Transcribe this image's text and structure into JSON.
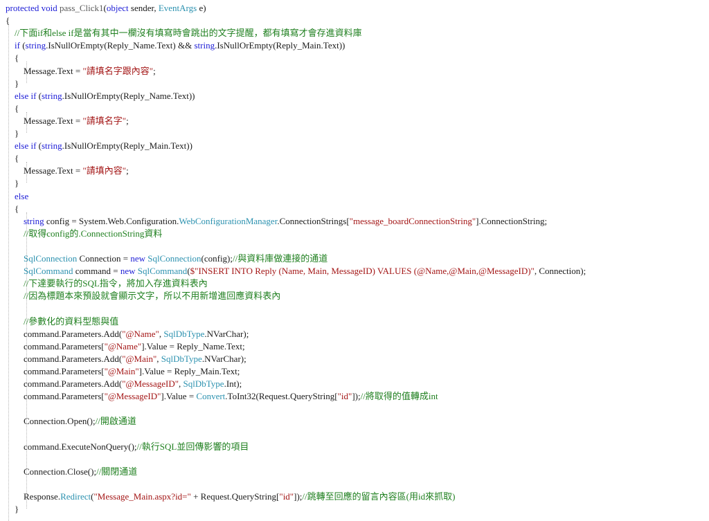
{
  "editor": {
    "lines": [
      [
        {
          "t": "protected void ",
          "c": "kw"
        },
        {
          "t": "pass_Click1",
          "c": "fn"
        },
        {
          "t": "(",
          "c": "pl"
        },
        {
          "t": "object",
          "c": "kw"
        },
        {
          "t": " sender, ",
          "c": "pl"
        },
        {
          "t": "EventArgs",
          "c": "ty"
        },
        {
          "t": " e)",
          "c": "pl"
        }
      ],
      [
        {
          "t": "{",
          "c": "pl"
        }
      ],
      [
        {
          "t": "    //下面if和else if是當有其中一欄沒有填寫時會跳出的文字提醒，都有填寫才會存進資料庫",
          "c": "cm"
        }
      ],
      [
        {
          "t": "    ",
          "c": "pl"
        },
        {
          "t": "if",
          "c": "kw"
        },
        {
          "t": " (",
          "c": "pl"
        },
        {
          "t": "string",
          "c": "kw"
        },
        {
          "t": ".IsNullOrEmpty(Reply_Name.Text) && ",
          "c": "pl"
        },
        {
          "t": "string",
          "c": "kw"
        },
        {
          "t": ".IsNullOrEmpty(Reply_Main.Text))",
          "c": "pl"
        }
      ],
      [
        {
          "t": "    {",
          "c": "pl"
        }
      ],
      [
        {
          "t": "        Message.Text = ",
          "c": "pl"
        },
        {
          "t": "\"請填名字跟內容\"",
          "c": "str"
        },
        {
          "t": ";",
          "c": "pl"
        }
      ],
      [
        {
          "t": "    }",
          "c": "pl"
        }
      ],
      [
        {
          "t": "    ",
          "c": "pl"
        },
        {
          "t": "else if",
          "c": "kw"
        },
        {
          "t": " (",
          "c": "pl"
        },
        {
          "t": "string",
          "c": "kw"
        },
        {
          "t": ".IsNullOrEmpty(Reply_Name.Text))",
          "c": "pl"
        }
      ],
      [
        {
          "t": "    {",
          "c": "pl"
        }
      ],
      [
        {
          "t": "        Message.Text = ",
          "c": "pl"
        },
        {
          "t": "\"請填名字\"",
          "c": "str"
        },
        {
          "t": ";",
          "c": "pl"
        }
      ],
      [
        {
          "t": "    }",
          "c": "pl"
        }
      ],
      [
        {
          "t": "    ",
          "c": "pl"
        },
        {
          "t": "else if",
          "c": "kw"
        },
        {
          "t": " (",
          "c": "pl"
        },
        {
          "t": "string",
          "c": "kw"
        },
        {
          "t": ".IsNullOrEmpty(Reply_Main.Text))",
          "c": "pl"
        }
      ],
      [
        {
          "t": "    {",
          "c": "pl"
        }
      ],
      [
        {
          "t": "        Message.Text = ",
          "c": "pl"
        },
        {
          "t": "\"請填內容\"",
          "c": "str"
        },
        {
          "t": ";",
          "c": "pl"
        }
      ],
      [
        {
          "t": "    }",
          "c": "pl"
        }
      ],
      [
        {
          "t": "    ",
          "c": "pl"
        },
        {
          "t": "else",
          "c": "kw"
        }
      ],
      [
        {
          "t": "    {",
          "c": "pl"
        }
      ],
      [
        {
          "t": "        ",
          "c": "pl"
        },
        {
          "t": "string",
          "c": "kw"
        },
        {
          "t": " config = System.Web.Configuration.",
          "c": "pl"
        },
        {
          "t": "WebConfigurationManager",
          "c": "ty"
        },
        {
          "t": ".ConnectionStrings[",
          "c": "pl"
        },
        {
          "t": "\"message_boardConnectionString\"",
          "c": "str"
        },
        {
          "t": "].ConnectionString;",
          "c": "pl"
        }
      ],
      [
        {
          "t": "        //取得config的.ConnectionString資料",
          "c": "cm"
        }
      ],
      [
        {
          "t": "",
          "c": "pl"
        }
      ],
      [
        {
          "t": "        ",
          "c": "pl"
        },
        {
          "t": "SqlConnection",
          "c": "ty"
        },
        {
          "t": " Connection = ",
          "c": "pl"
        },
        {
          "t": "new",
          "c": "kw"
        },
        {
          "t": " ",
          "c": "pl"
        },
        {
          "t": "SqlConnection",
          "c": "ty"
        },
        {
          "t": "(config);",
          "c": "pl"
        },
        {
          "t": "//與資料庫做連接的通道",
          "c": "cm"
        }
      ],
      [
        {
          "t": "        ",
          "c": "pl"
        },
        {
          "t": "SqlCommand",
          "c": "ty"
        },
        {
          "t": " command = ",
          "c": "pl"
        },
        {
          "t": "new",
          "c": "kw"
        },
        {
          "t": " ",
          "c": "pl"
        },
        {
          "t": "SqlCommand",
          "c": "ty"
        },
        {
          "t": "(",
          "c": "pl"
        },
        {
          "t": "$\"INSERT INTO Reply (Name, Main, MessageID) VALUES (@Name,@Main,@MessageID)\"",
          "c": "str"
        },
        {
          "t": ", Connection);",
          "c": "pl"
        }
      ],
      [
        {
          "t": "        //下達要執行的SQL指令，將加入存進資料表內",
          "c": "cm"
        }
      ],
      [
        {
          "t": "        //因為標題本來預設就會顯示文字，所以不用新增進回應資料表內",
          "c": "cm"
        }
      ],
      [
        {
          "t": "",
          "c": "pl"
        }
      ],
      [
        {
          "t": "        //參數化的資料型態與值",
          "c": "cm"
        }
      ],
      [
        {
          "t": "        command.Parameters.Add(",
          "c": "pl"
        },
        {
          "t": "\"@Name\"",
          "c": "str"
        },
        {
          "t": ", ",
          "c": "pl"
        },
        {
          "t": "SqlDbType",
          "c": "ty"
        },
        {
          "t": ".NVarChar);",
          "c": "pl"
        }
      ],
      [
        {
          "t": "        command.Parameters[",
          "c": "pl"
        },
        {
          "t": "\"@Name\"",
          "c": "str"
        },
        {
          "t": "].Value = Reply_Name.Text;",
          "c": "pl"
        }
      ],
      [
        {
          "t": "        command.Parameters.Add(",
          "c": "pl"
        },
        {
          "t": "\"@Main\"",
          "c": "str"
        },
        {
          "t": ", ",
          "c": "pl"
        },
        {
          "t": "SqlDbType",
          "c": "ty"
        },
        {
          "t": ".NVarChar);",
          "c": "pl"
        }
      ],
      [
        {
          "t": "        command.Parameters[",
          "c": "pl"
        },
        {
          "t": "\"@Main\"",
          "c": "str"
        },
        {
          "t": "].Value = Reply_Main.Text;",
          "c": "pl"
        }
      ],
      [
        {
          "t": "        command.Parameters.Add(",
          "c": "pl"
        },
        {
          "t": "\"@MessageID\"",
          "c": "str"
        },
        {
          "t": ", ",
          "c": "pl"
        },
        {
          "t": "SqlDbType",
          "c": "ty"
        },
        {
          "t": ".Int);",
          "c": "pl"
        }
      ],
      [
        {
          "t": "        command.Parameters[",
          "c": "pl"
        },
        {
          "t": "\"@MessageID\"",
          "c": "str"
        },
        {
          "t": "].Value = ",
          "c": "pl"
        },
        {
          "t": "Convert",
          "c": "ty"
        },
        {
          "t": ".ToInt32(Request.QueryString[",
          "c": "pl"
        },
        {
          "t": "\"id\"",
          "c": "str"
        },
        {
          "t": "]);",
          "c": "pl"
        },
        {
          "t": "//將取得的值轉成int",
          "c": "cm"
        }
      ],
      [
        {
          "t": "",
          "c": "pl"
        }
      ],
      [
        {
          "t": "        Connection.Open();",
          "c": "pl"
        },
        {
          "t": "//開啟通道",
          "c": "cm"
        }
      ],
      [
        {
          "t": "",
          "c": "pl"
        }
      ],
      [
        {
          "t": "        command.ExecuteNonQuery();",
          "c": "pl"
        },
        {
          "t": "//執行SQL並回傳影響的項目",
          "c": "cm"
        }
      ],
      [
        {
          "t": "",
          "c": "pl"
        }
      ],
      [
        {
          "t": "        Connection.Close();",
          "c": "pl"
        },
        {
          "t": "//關閉通道",
          "c": "cm"
        }
      ],
      [
        {
          "t": "",
          "c": "pl"
        }
      ],
      [
        {
          "t": "        Response.",
          "c": "pl"
        },
        {
          "t": "Redirect",
          "c": "ty"
        },
        {
          "t": "(",
          "c": "pl"
        },
        {
          "t": "\"Message_Main.aspx?id=\"",
          "c": "str"
        },
        {
          "t": " + Request.QueryString[",
          "c": "pl"
        },
        {
          "t": "\"id\"",
          "c": "str"
        },
        {
          "t": "]);",
          "c": "pl"
        },
        {
          "t": "//跳轉至回應的留言內容區(用id來抓取)",
          "c": "cm"
        }
      ],
      [
        {
          "t": "    }",
          "c": "pl"
        }
      ]
    ]
  },
  "colors": {
    "keyword": "#1c1cd6",
    "type": "#2b91af",
    "string": "#a31515",
    "comment": "#208020",
    "plain": "#1a1a1a",
    "background": "#ffffff",
    "guide": "#b5b5b5"
  }
}
